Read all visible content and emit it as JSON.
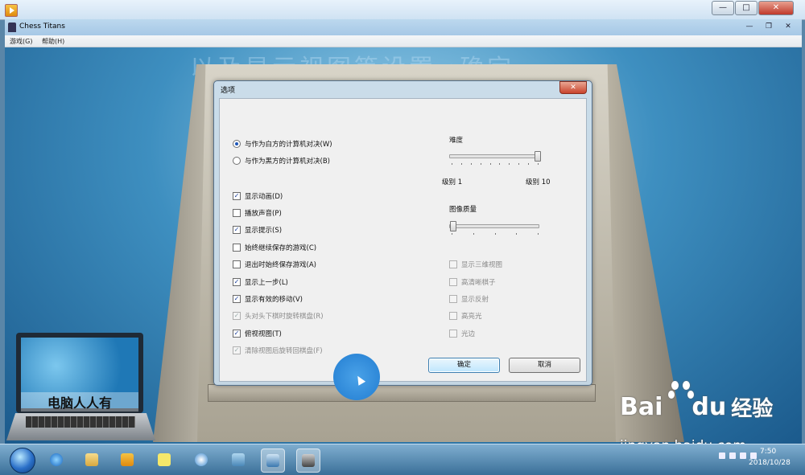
{
  "outer_window": {
    "buttons": {
      "minimize": "—",
      "maximize": "□",
      "close": "✕"
    }
  },
  "game_window": {
    "title": "Chess Titans",
    "buttons": {
      "minimize": "—",
      "maximize": "❐",
      "close": "✕"
    },
    "menu": [
      "游戏(G)",
      "帮助(H)"
    ],
    "overlay_text": "以及显示视图等设置→确定"
  },
  "dialog": {
    "title": "选项",
    "close": "✕",
    "play_modes": [
      {
        "label": "与作为白方的计算机对决(W)",
        "selected": true
      },
      {
        "label": "与作为黑方的计算机对决(B)",
        "selected": false
      }
    ],
    "options_left": [
      {
        "label": "显示动画(D)",
        "checked": true,
        "enabled": true
      },
      {
        "label": "播放声音(P)",
        "checked": false,
        "enabled": true
      },
      {
        "label": "显示提示(S)",
        "checked": true,
        "enabled": true
      },
      {
        "label": "始终继续保存的游戏(C)",
        "checked": false,
        "enabled": true
      },
      {
        "label": "退出时始终保存游戏(A)",
        "checked": false,
        "enabled": true
      },
      {
        "label": "显示上一步(L)",
        "checked": true,
        "enabled": true
      },
      {
        "label": "显示有效的移动(V)",
        "checked": true,
        "enabled": true
      },
      {
        "label": "头对头下棋时旋转棋盘(R)",
        "checked": true,
        "enabled": false
      },
      {
        "label": "俯视视图(T)",
        "checked": true,
        "enabled": true
      },
      {
        "label": "清除视图后旋转回棋盘(F)",
        "checked": true,
        "enabled": false
      }
    ],
    "difficulty": {
      "label": "难度",
      "min_label": "级别 1",
      "max_label": "级别 10",
      "value": 10,
      "min": 1,
      "max": 10
    },
    "image_quality": {
      "label": "图像质量",
      "value_fraction": 0.0
    },
    "options_right": [
      {
        "label": "显示三维视图",
        "checked": false,
        "enabled": false
      },
      {
        "label": "高清晰棋子",
        "checked": false,
        "enabled": false
      },
      {
        "label": "显示反射",
        "checked": false,
        "enabled": false
      },
      {
        "label": "高亮光",
        "checked": false,
        "enabled": false
      },
      {
        "label": "光边",
        "checked": false,
        "enabled": false
      }
    ],
    "ok_button": "确定",
    "cancel_button": "取消"
  },
  "watermarks": {
    "laptop_caption": "电脑人人有",
    "baidu_brand": "Bai",
    "baidu_du": "du",
    "baidu_jingyan": "经验",
    "baidu_url": "jingyan.baidu.com"
  },
  "taskbar": {
    "time": "7:50",
    "date": "2018/10/28"
  },
  "colors": {
    "accent_blue": "#2e88d8",
    "dialog_frame": "#c8def0",
    "close_red": "#c9432c"
  }
}
